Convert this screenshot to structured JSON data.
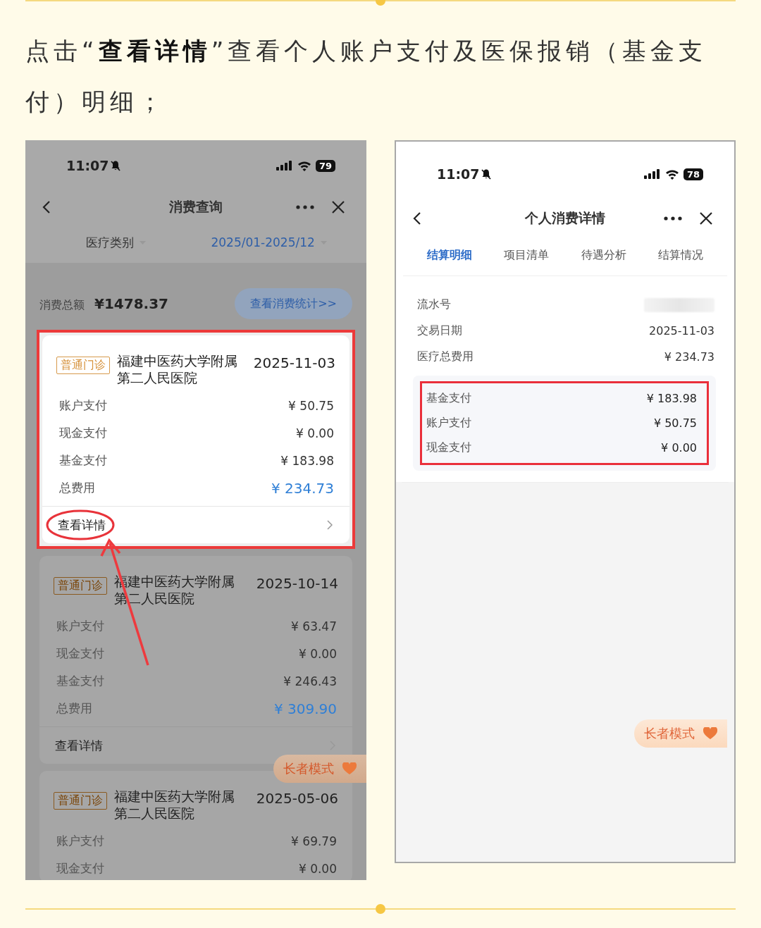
{
  "intro": "点击“**查看详情**”查看个人账户支付及医保报销（基金支付）明细；",
  "left_phone": {
    "status_bar": {
      "time": "11:07",
      "battery": "79"
    },
    "title": "消费查询",
    "filters": [
      {
        "label": "医疗类别",
        "kind": "category"
      },
      {
        "label": "2025/01-2025/12",
        "kind": "date"
      }
    ],
    "summary": {
      "label": "消费总额",
      "amount": "¥1478.37",
      "button": "查看消费统计>>"
    },
    "records": [
      {
        "highlighted": true,
        "tag": "普通门诊",
        "hospital": "福建中医药大学附属第二人民医院",
        "date": "2025-11-03",
        "rows": [
          {
            "label": "账户支付",
            "value": "¥ 50.75",
            "kind": "plain"
          },
          {
            "label": "现金支付",
            "value": "¥ 0.00",
            "kind": "plain"
          },
          {
            "label": "基金支付",
            "value": "¥ 183.98",
            "kind": "plain"
          },
          {
            "label": "总费用",
            "value": "¥ 234.73",
            "kind": "total"
          }
        ],
        "link": "查看详情"
      },
      {
        "highlighted": false,
        "tag": "普通门诊",
        "hospital": "福建中医药大学附属第二人民医院",
        "date": "2025-10-14",
        "rows": [
          {
            "label": "账户支付",
            "value": "¥ 63.47",
            "kind": "plain"
          },
          {
            "label": "现金支付",
            "value": "¥ 0.00",
            "kind": "plain"
          },
          {
            "label": "基金支付",
            "value": "¥ 246.43",
            "kind": "plain"
          },
          {
            "label": "总费用",
            "value": "¥ 309.90",
            "kind": "total"
          }
        ],
        "link": "查看详情"
      },
      {
        "highlighted": false,
        "tag": "普通门诊",
        "hospital": "福建中医药大学附属第二人民医院",
        "date": "2025-05-06",
        "rows": [
          {
            "label": "账户支付",
            "value": "¥ 69.79",
            "kind": "plain"
          },
          {
            "label": "现金支付",
            "value": "¥ 0.00",
            "kind": "plain"
          }
        ]
      }
    ],
    "elder_mode": "长者模式"
  },
  "right_phone": {
    "status_bar": {
      "time": "11:07",
      "battery": "78"
    },
    "title": "个人消费详情",
    "tabs": [
      {
        "label": "结算明细",
        "selected": true
      },
      {
        "label": "项目清单",
        "selected": false
      },
      {
        "label": "待遇分析",
        "selected": false
      },
      {
        "label": "结算情况",
        "selected": false
      }
    ],
    "info_rows": [
      {
        "label": "流水号",
        "kind": "blurred"
      },
      {
        "label": "交易日期",
        "value": "2025-11-03",
        "kind": "plain"
      },
      {
        "label": "医疗总费用",
        "value": "¥ 234.73",
        "kind": "plain"
      }
    ],
    "fund_rows": [
      {
        "label": "基金支付",
        "value": "¥ 183.98"
      },
      {
        "label": "账户支付",
        "value": "¥ 50.75"
      },
      {
        "label": "现金支付",
        "value": "¥ 0.00"
      }
    ],
    "elder_mode": "长者模式"
  }
}
